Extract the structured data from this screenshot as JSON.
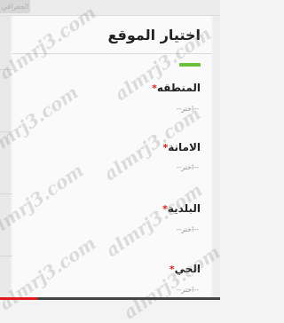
{
  "topbar": {
    "tab_label": "الجغرافي"
  },
  "panel": {
    "title": "اختيار الموقع",
    "fields": [
      {
        "label": "المنطقه",
        "placeholder": "--اختر--"
      },
      {
        "label": "الامانة",
        "placeholder": "--اختر--"
      },
      {
        "label": "البلدية",
        "placeholder": "--اختر--"
      },
      {
        "label": "الحي",
        "placeholder": "--اختر--"
      }
    ],
    "required_mark": "*"
  },
  "watermark": {
    "text": "almrj3.com"
  },
  "video_progress": {
    "fraction": 0.17
  },
  "colors": {
    "accent": "#6abf3b",
    "required": "#d22020",
    "progress": "#e01919"
  }
}
